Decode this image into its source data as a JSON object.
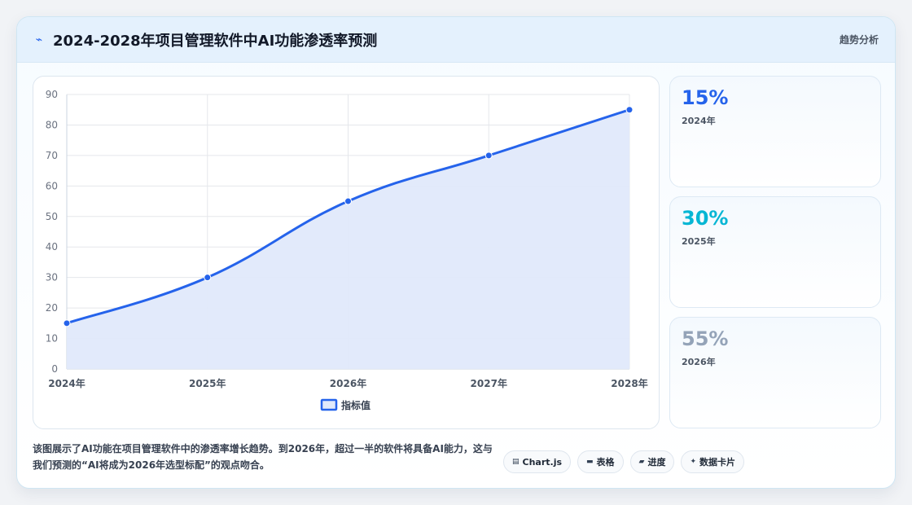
{
  "header": {
    "icon": "trend-line-icon",
    "title": "2024-2028年项目管理软件中AI功能渗透率预测",
    "tag": "趋势分析"
  },
  "chart_data": {
    "type": "area",
    "categories": [
      "2024年",
      "2025年",
      "2026年",
      "2027年",
      "2028年"
    ],
    "series": [
      {
        "name": "指标值",
        "values": [
          15,
          30,
          55,
          70,
          85
        ],
        "color": "#2563eb",
        "fill": "#e0e9fb"
      }
    ],
    "title": "",
    "xlabel": "",
    "ylabel": "",
    "ylim": [
      0,
      90
    ],
    "yticks": [
      0,
      10,
      20,
      30,
      40,
      50,
      60,
      70,
      80,
      90
    ],
    "grid": true,
    "legend": "bottom"
  },
  "stats": [
    {
      "value": "15%",
      "label": "2024年",
      "color": "#2563eb"
    },
    {
      "value": "30%",
      "label": "2025年",
      "color": "#06b6d4"
    },
    {
      "value": "55%",
      "label": "2026年",
      "color": "#94a3b8"
    }
  ],
  "footer": {
    "description": "该图展示了AI功能在项目管理软件中的渗透率增长趋势。到2026年，超过一半的软件将具备AI能力，这与我们预测的“AI将成为2026年选型标配”的观点吻合。"
  },
  "chips": [
    {
      "icon": "chart-icon",
      "glyph": "▤",
      "label": "Chart.js"
    },
    {
      "icon": "table-icon",
      "glyph": "▬",
      "label": "表格"
    },
    {
      "icon": "progress-icon",
      "glyph": "▰",
      "label": "进度"
    },
    {
      "icon": "sparkle-icon",
      "glyph": "✦",
      "label": "数据卡片"
    }
  ]
}
